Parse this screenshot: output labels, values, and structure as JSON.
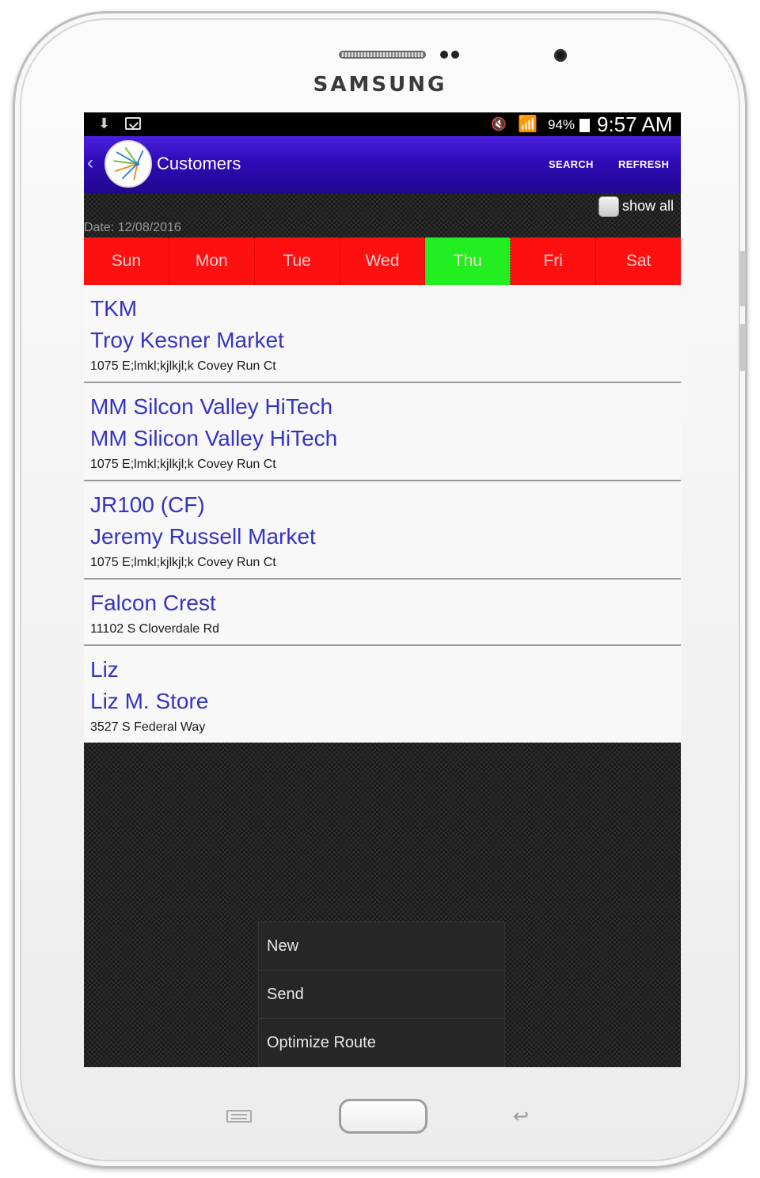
{
  "device": {
    "brand": "SAMSUNG"
  },
  "status_bar": {
    "battery_percent": "94%",
    "time": "9:57 AM",
    "icons": [
      "usb-icon",
      "bag-icon",
      "mute-icon",
      "wifi-icon",
      "battery-icon"
    ]
  },
  "action_bar": {
    "up_glyph": "‹",
    "title": "Customers",
    "search_label": "SEARCH",
    "refresh_label": "REFRESH",
    "color": "#2e0bb5"
  },
  "filters": {
    "show_all_label": "show all",
    "show_all_checked": false,
    "date_text": "Date: 12/08/2016"
  },
  "days": {
    "items": [
      {
        "label": "Sun"
      },
      {
        "label": "Mon"
      },
      {
        "label": "Tue"
      },
      {
        "label": "Wed"
      },
      {
        "label": "Thu"
      },
      {
        "label": "Fri"
      },
      {
        "label": "Sat"
      }
    ],
    "selected_index": 4,
    "active_color": "#22ee22",
    "inactive_color": "#ff1010"
  },
  "customers": [
    {
      "code": "TKM",
      "name": "Troy Kesner Market",
      "address": "1075 E;lmkl;kjlkjl;k Covey Run Ct"
    },
    {
      "code": "MM Silcon Valley HiTech",
      "name": "MM Silicon Valley HiTech",
      "address": "1075 E;lmkl;kjlkjl;k Covey Run Ct"
    },
    {
      "code": "JR100 (CF)",
      "name": "Jeremy Russell Market",
      "address": "1075 E;lmkl;kjlkjl;k Covey Run Ct"
    },
    {
      "code": "Falcon Crest",
      "name": "",
      "address": "11102 S Cloverdale Rd"
    },
    {
      "code": "Liz",
      "name": "Liz M. Store",
      "address": "3527 S Federal Way"
    }
  ],
  "menu": {
    "items": [
      {
        "label": "New"
      },
      {
        "label": "Send"
      },
      {
        "label": "Optimize Route"
      }
    ]
  },
  "hardware_keys": [
    "menu-key-icon",
    "home-key",
    "back-key-icon"
  ],
  "hardware_back_glyph": "↩"
}
